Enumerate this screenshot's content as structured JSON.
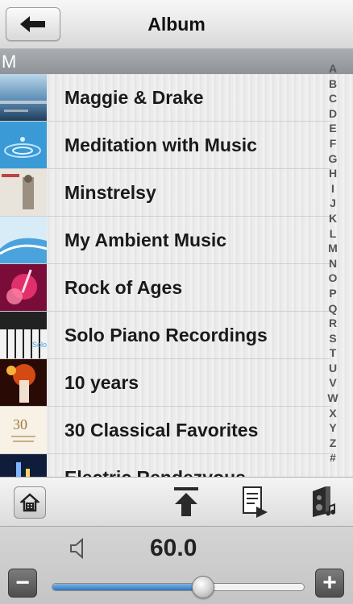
{
  "header": {
    "title": "Album",
    "back_icon": "arrow-left-icon"
  },
  "section": {
    "letter": "M"
  },
  "albums": [
    {
      "title": "Maggie & Drake"
    },
    {
      "title": "Meditation with Music"
    },
    {
      "title": "Minstrelsy"
    },
    {
      "title": "My Ambient Music"
    },
    {
      "title": "Rock of Ages"
    },
    {
      "title": "Solo Piano Recordings"
    },
    {
      "title": "10 years"
    },
    {
      "title": "30 Classical Favorites"
    },
    {
      "title": "Electric Rendezvous"
    }
  ],
  "index_letters": [
    "A",
    "B",
    "C",
    "D",
    "E",
    "F",
    "G",
    "H",
    "I",
    "J",
    "K",
    "L",
    "M",
    "N",
    "O",
    "P",
    "Q",
    "R",
    "S",
    "T",
    "U",
    "V",
    "W",
    "X",
    "Y",
    "Z",
    "#"
  ],
  "toolbar": {
    "icons": [
      "home-icon",
      "scroll-to-top-icon",
      "playlist-icon",
      "speaker-icon"
    ]
  },
  "volume": {
    "value": "60.0",
    "level": 0.6,
    "minus_label": "−",
    "plus_label": "+"
  },
  "colors": {
    "slider_fill": "#2f76bf",
    "section_header": "#9a9ea2"
  }
}
